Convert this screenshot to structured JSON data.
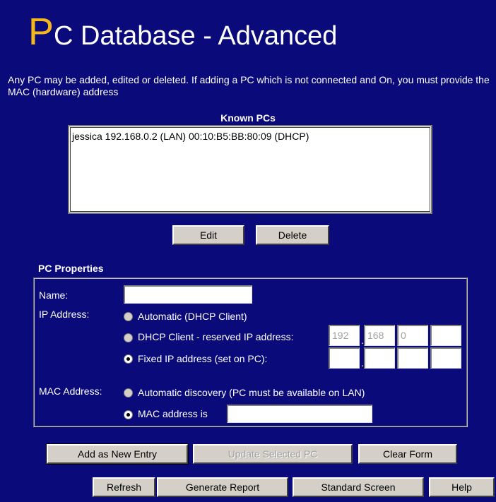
{
  "title": {
    "first_letter": "P",
    "rest": "C Database - Advanced"
  },
  "intro": "Any PC may be added, edited or deleted. If adding a PC which is not connected and On, you must provide the MAC (hardware) address",
  "known_pcs": {
    "label": "Known PCs",
    "items": [
      "jessica 192.168.0.2 (LAN) 00:10:B5:BB:80:09 (DHCP)"
    ],
    "edit_label": "Edit",
    "delete_label": "Delete"
  },
  "pc_properties": {
    "label": "PC Properties",
    "name_label": "Name:",
    "name_value": "",
    "ip_label": "IP Address:",
    "ip_auto": "Automatic (DHCP Client)",
    "ip_reserved": "DHCP Client - reserved IP address:",
    "reserved_ip": [
      "192",
      "168",
      "0",
      ""
    ],
    "ip_fixed": "Fixed IP address (set on PC):",
    "fixed_ip": [
      "",
      "",
      "",
      ""
    ],
    "mac_label": "MAC Address:",
    "mac_auto": "Automatic discovery (PC must be available on LAN)",
    "mac_is": "MAC address is",
    "mac_value": ""
  },
  "buttons": {
    "add": "Add as New Entry",
    "update": "Update Selected PC",
    "clear": "Clear Form",
    "refresh": "Refresh",
    "report": "Generate Report",
    "standard": "Standard Screen",
    "help": "Help"
  },
  "colors": {
    "background": "#0a0a7a",
    "accent": "#f5b81c",
    "button": "#d4d0c8"
  }
}
